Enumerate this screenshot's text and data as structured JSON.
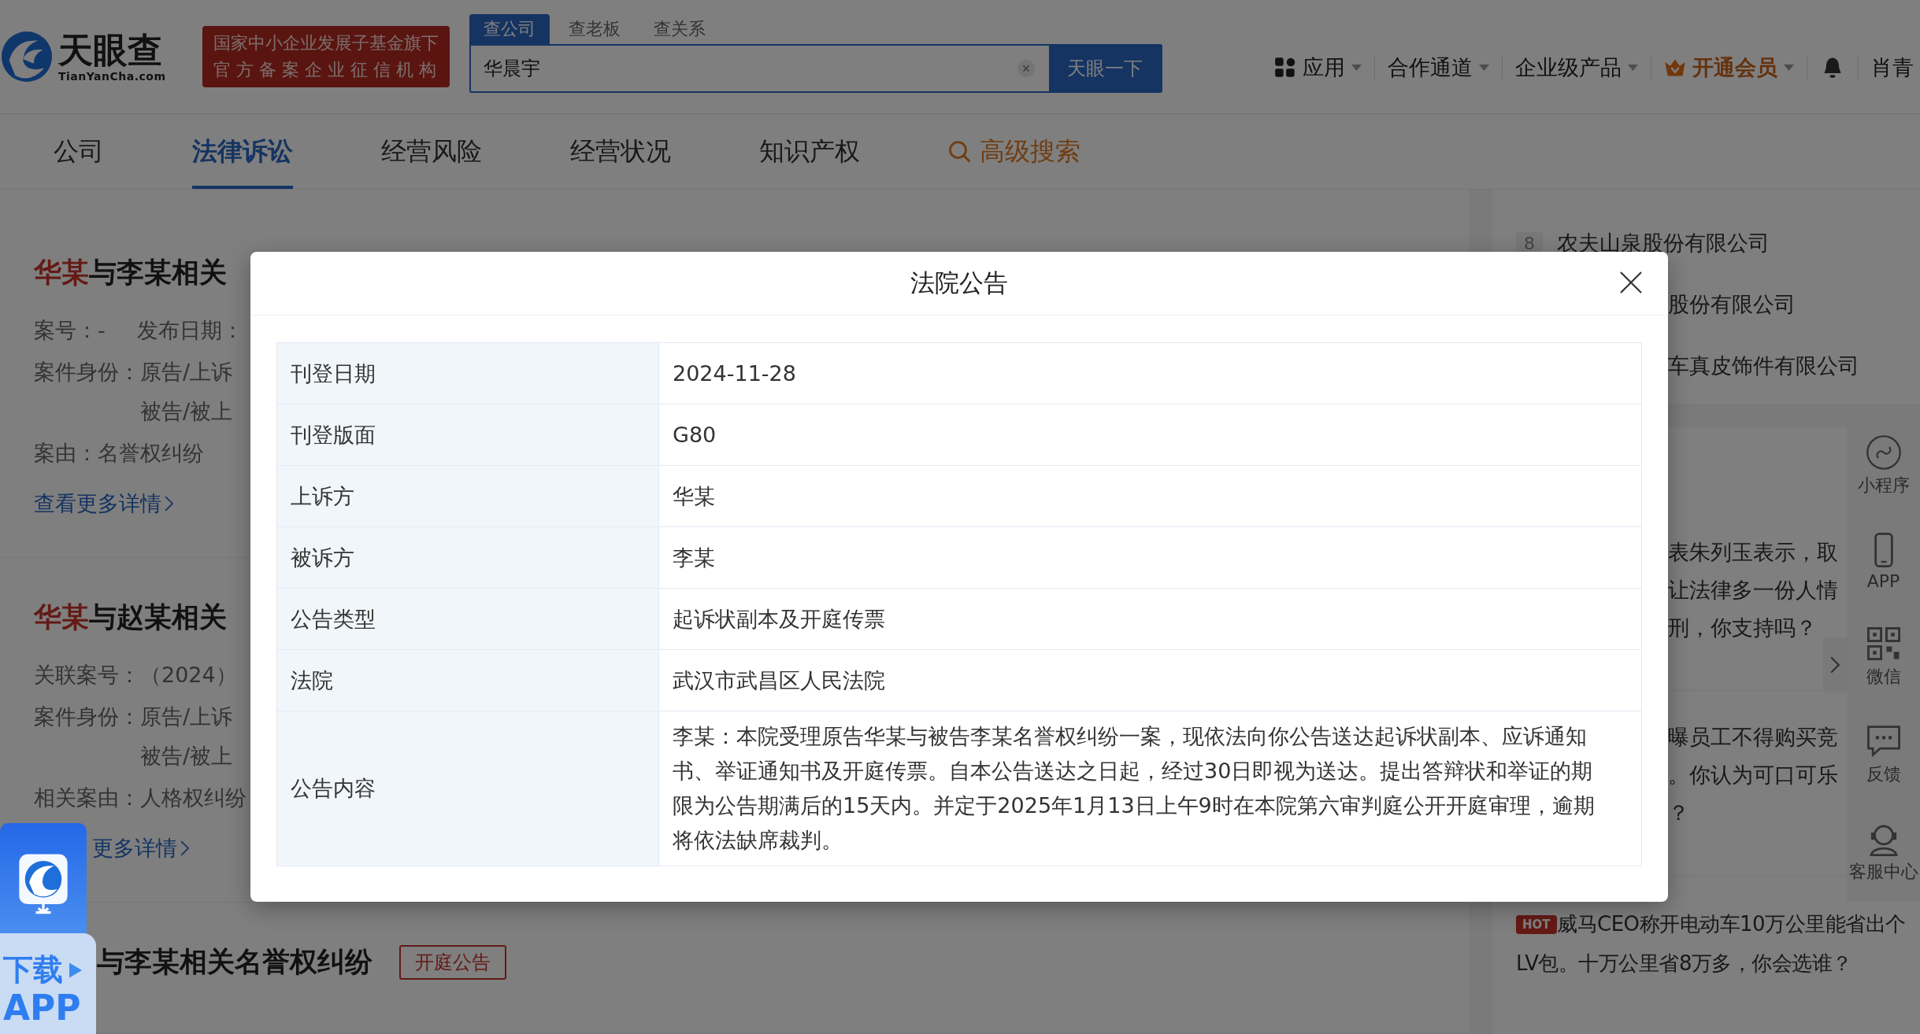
{
  "header": {
    "logo": {
      "name": "天眼查",
      "domain": "TianYanCha.com"
    },
    "badge": [
      "国家中小企业发展子基金旗下",
      "官 方 备 案 企 业 征 信 机 构"
    ],
    "search": {
      "tabs": [
        {
          "label": "查公司",
          "selected": true
        },
        {
          "label": "查老板",
          "selected": false
        },
        {
          "label": "查关系",
          "selected": false
        }
      ],
      "value": "华晨宇",
      "button": "天眼一下"
    },
    "nav": [
      {
        "label": "应用",
        "kind": "apps"
      },
      {
        "label": "合作通道",
        "kind": "menu"
      },
      {
        "label": "企业级产品",
        "kind": "menu"
      },
      {
        "label": "开通会员",
        "kind": "vip"
      }
    ],
    "user": "肖青"
  },
  "tabs": [
    {
      "label": "公司",
      "selected": false,
      "kind": "tab"
    },
    {
      "label": "法律诉讼",
      "selected": true,
      "kind": "tab"
    },
    {
      "label": "经营风险",
      "selected": false,
      "kind": "tab"
    },
    {
      "label": "经营状况",
      "selected": false,
      "kind": "tab"
    },
    {
      "label": "知识产权",
      "selected": false,
      "kind": "tab"
    },
    {
      "label": "高级搜索",
      "selected": false,
      "kind": "search"
    }
  ],
  "cases": [
    {
      "title_mark": "华某",
      "title": "与李某相关",
      "rows": [
        {
          "items": [
            {
              "label": "案号：",
              "value": "-"
            },
            {
              "label": "发布日期："
            }
          ]
        },
        {
          "items": [
            {
              "label": "案件身份：",
              "values": [
                "原告/上诉",
                "被告/被上"
              ]
            }
          ]
        },
        {
          "items": [
            {
              "label": "案由：",
              "value": "名誉权纠纷"
            }
          ]
        }
      ],
      "link": "查看更多详情"
    },
    {
      "title_mark": "华某",
      "title": "与赵某相关",
      "rows": [
        {
          "items": [
            {
              "label": "关联案号：",
              "value": "（2024）"
            }
          ]
        },
        {
          "items": [
            {
              "label": "案件身份：",
              "values": [
                "原告/上诉",
                "被告/被上"
              ]
            }
          ]
        },
        {
          "items": [
            {
              "label": "相关案由：",
              "value": "人格权纠纷"
            }
          ]
        }
      ],
      "link": "更多详情"
    },
    {
      "title": "与李某相关名誉权纠纷",
      "tag": "开庭公告"
    }
  ],
  "right": {
    "companies": [
      {
        "rank": "8",
        "name": "农夫山泉股份有限公司"
      },
      {
        "name": "股份有限公司"
      },
      {
        "name": "车真皮饰件有限公司"
      }
    ],
    "news": [
      {
        "lines": [
          "表朱列玉表示，取",
          "让法律多一份人情",
          "刑，你支持吗？"
        ]
      },
      {
        "lines": [
          "曝员工不得购买竞",
          "。你认为可口可乐",
          "？"
        ]
      }
    ],
    "hot": {
      "badge": "HOT",
      "text": "威马CEO称开电动车10万公里能省出个LV包。十万公里省8万多，你会选谁？"
    }
  },
  "toolbar": [
    {
      "label": "小程序",
      "kind": "mini"
    },
    {
      "label": "APP",
      "kind": "phone"
    },
    {
      "label": "微信",
      "kind": "qr"
    },
    {
      "label": "反馈",
      "kind": "chat"
    },
    {
      "label": "客服中心",
      "kind": "service"
    }
  ],
  "download": {
    "lines": [
      "下载",
      "APP"
    ]
  },
  "modal": {
    "title": "法院公告",
    "rows": [
      {
        "label": "刊登日期",
        "value": "2024-11-28"
      },
      {
        "label": "刊登版面",
        "value": "G80"
      },
      {
        "label": "上诉方",
        "value": "华某"
      },
      {
        "label": "被诉方",
        "value": "李某"
      },
      {
        "label": "公告类型",
        "value": "起诉状副本及开庭传票"
      },
      {
        "label": "法院",
        "value": "武汉市武昌区人民法院"
      },
      {
        "label": "公告内容",
        "value": "李某：本院受理原告华某与被告李某名誉权纠纷一案，现依法向你公告送达起诉状副本、应诉通知书、举证通知书及开庭传票。自本公告送达之日起，经过30日即视为送达。提出答辩状和举证的期限为公告期满后的15天内。并定于2025年1月13日上午9时在本院第六审判庭公开开庭审理，逾期将依法缺席裁判。"
      }
    ]
  }
}
